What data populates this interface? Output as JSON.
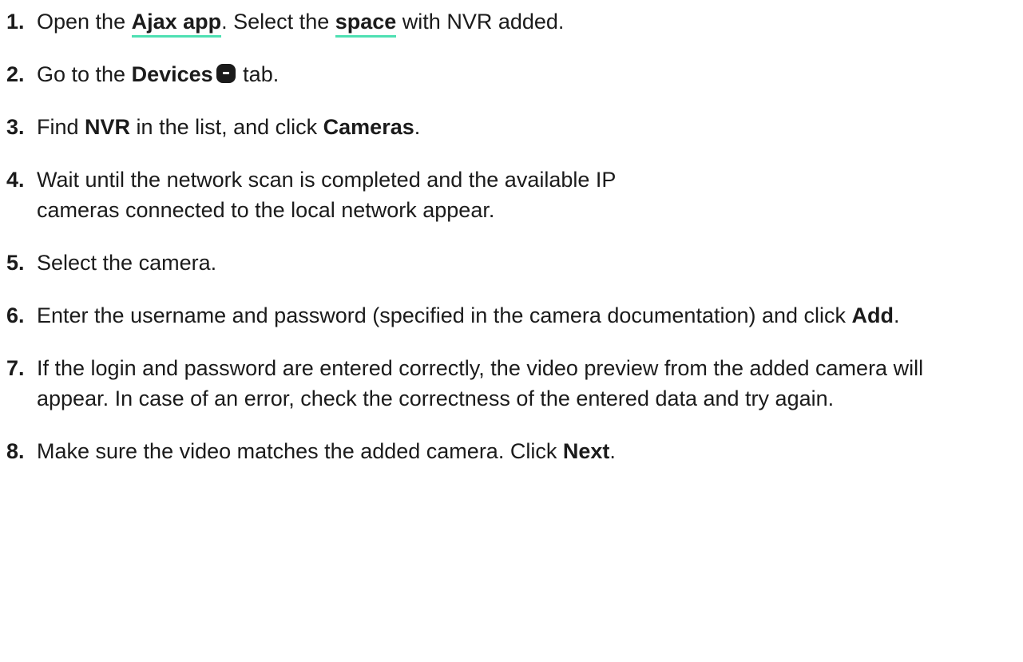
{
  "steps": [
    {
      "num": "1.",
      "t1": "Open the ",
      "link1": "Ajax app",
      "t2": ". Select the ",
      "link2": "space",
      "t3": " with NVR added."
    },
    {
      "num": "2.",
      "t1": "Go to the ",
      "b1": "Devices",
      "icon": "devices-tab-icon",
      "t2": " tab."
    },
    {
      "num": "3.",
      "t1": "Find ",
      "b1": "NVR",
      "t2": " in the list, and click ",
      "b2": "Cameras",
      "t3": "."
    },
    {
      "num": "4.",
      "t1": "Wait until the network scan is completed and the available IP cameras connected to the local network appear."
    },
    {
      "num": "5.",
      "t1": "Select the camera."
    },
    {
      "num": "6.",
      "t1": "Enter the username and password (specified in the camera documentation) and click ",
      "b1": "Add",
      "t2": "."
    },
    {
      "num": "7.",
      "t1": "If the login and password are entered correctly, the video preview from the added camera will appear. In case of an error, check the correctness of the entered data and try again."
    },
    {
      "num": "8.",
      "t1": "Make sure the video matches the added camera. Click ",
      "b1": "Next",
      "t2": "."
    }
  ],
  "colors": {
    "text": "#1b1b1b",
    "link_underline": "#4ee0b2"
  }
}
